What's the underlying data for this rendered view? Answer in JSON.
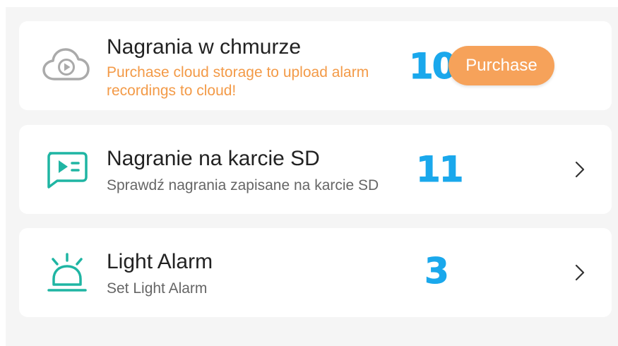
{
  "items": [
    {
      "title": "Nagrania w chmurze",
      "subtitle": "Purchase cloud storage to upload alarm recordings to cloud!",
      "icon": "cloud-play-icon",
      "button_label": "Purchase",
      "badge": "10"
    },
    {
      "title": "Nagranie na karcie SD",
      "subtitle": "Sprawdź nagrania zapisane na karcie SD",
      "icon": "sd-card-recording-icon",
      "badge": "11"
    },
    {
      "title": "Light Alarm",
      "subtitle": "Set Light Alarm",
      "icon": "alarm-light-icon",
      "badge": "3"
    }
  ],
  "colors": {
    "accent_orange": "#f39a47",
    "button_orange": "#f6a25a",
    "icon_teal": "#1fb5a3",
    "badge_blue": "#1aa8ec",
    "icon_gray": "#aaaaaa"
  }
}
